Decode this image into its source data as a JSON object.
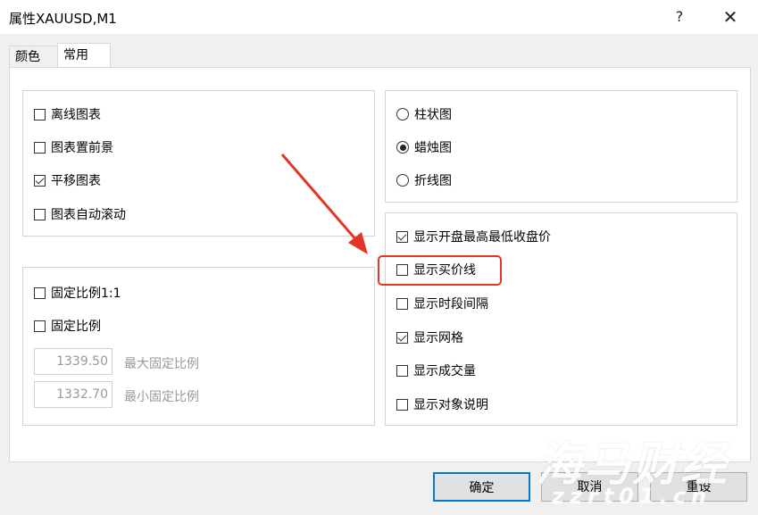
{
  "window": {
    "title": "属性XAUUSD,M1",
    "help": "?",
    "close": "✕"
  },
  "tabs": [
    {
      "label": "颜色"
    },
    {
      "label": "常用"
    }
  ],
  "left_top": [
    {
      "label": "离线图表",
      "checked": false
    },
    {
      "label": "图表置前景",
      "checked": false
    },
    {
      "label": "平移图表",
      "checked": true
    },
    {
      "label": "图表自动滚动",
      "checked": false
    }
  ],
  "left_bottom": {
    "fixed_scale_1_1": {
      "label": "固定比例1:1",
      "checked": false
    },
    "fixed_scale": {
      "label": "固定比例",
      "checked": false
    },
    "max": {
      "value": "1339.50",
      "label": "最大固定比例"
    },
    "min": {
      "value": "1332.70",
      "label": "最小固定比例"
    }
  },
  "chart_type": [
    {
      "label": "柱状图",
      "selected": false
    },
    {
      "label": "蜡烛图",
      "selected": true
    },
    {
      "label": "折线图",
      "selected": false
    }
  ],
  "show_options": [
    {
      "label": "显示开盘最高最低收盘价",
      "checked": true
    },
    {
      "label": "显示买价线",
      "checked": false
    },
    {
      "label": "显示时段间隔",
      "checked": false
    },
    {
      "label": "显示网格",
      "checked": true
    },
    {
      "label": "显示成交量",
      "checked": false
    },
    {
      "label": "显示对象说明",
      "checked": false
    }
  ],
  "buttons": {
    "ok": "确定",
    "cancel": "取消",
    "reset": "重设"
  },
  "watermark": {
    "line1": "海马财经",
    "line2": "zzrt01.cn"
  },
  "colors": {
    "highlight": "#e53527",
    "accent": "#0078d7"
  }
}
